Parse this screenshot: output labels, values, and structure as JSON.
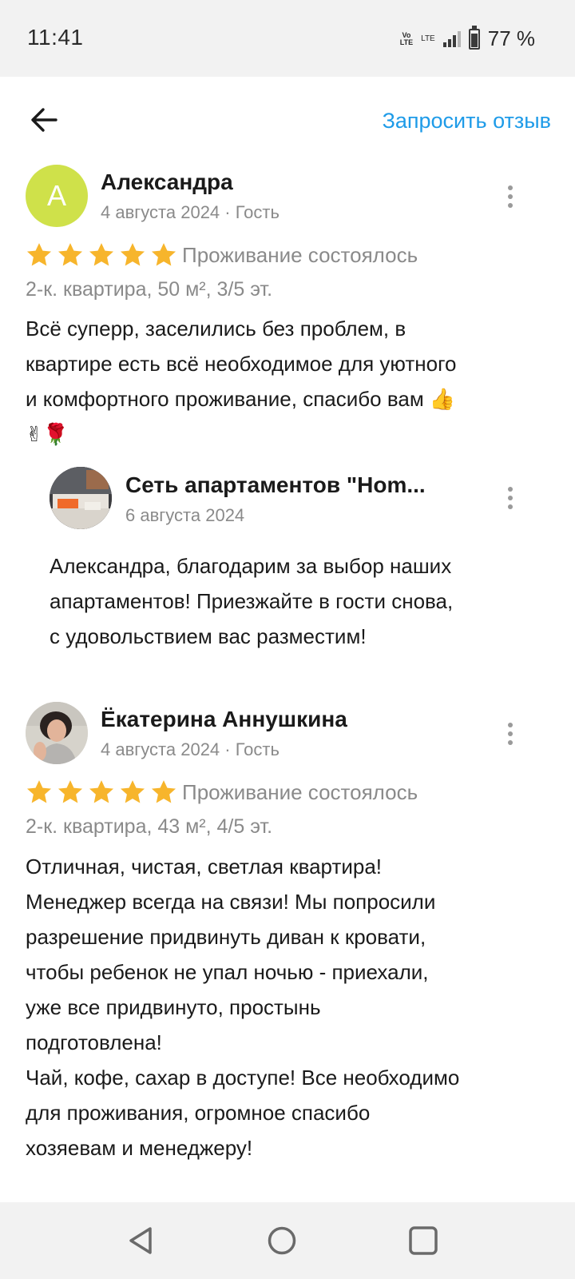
{
  "status_bar": {
    "time": "11:41",
    "network": "LTE",
    "volte": "Vo LTE",
    "battery_percent": "77 %",
    "battery_level": 0.77
  },
  "header": {
    "back_icon": "arrow-left-icon",
    "request_review_label": "Запросить отзыв",
    "accent_color": "#1e9be8"
  },
  "reviews": [
    {
      "avatar_letter": "А",
      "avatar_color": "#cfe14a",
      "author": "Александра",
      "meta": "4 августа 2024 · Гость",
      "rating": 5,
      "stay_status": "Проживание состоялось",
      "apartment": "2-к. квартира, 50 м², 3/5 эт.",
      "text": [
        "Всё суперр, заселились без проблем, в",
        "квартире есть всё необходимое для уютного",
        "и комфортного проживание, спасибо вам 👍",
        "✌🌹"
      ],
      "reply": {
        "author": "Сеть апартаментов \"Hom...",
        "date": "6 августа 2024",
        "text": [
          "Александра, благодарим за выбор наших",
          "апартаментов! Приезжайте в гости снова,",
          "с удовольствием вас разместим!"
        ]
      }
    },
    {
      "author": "Ёкатерина Аннушкина",
      "meta": "4 августа 2024 · Гость",
      "rating": 5,
      "stay_status": "Проживание состоялось",
      "apartment": "2-к. квартира, 43 м², 4/5 эт.",
      "text": [
        "Отличная, чистая, светлая квартира!",
        "Менеджер всегда на связи! Мы попросили",
        "разрешение придвинуть диван к кровати,",
        "чтобы ребенок не упал ночью - приехали,",
        "уже все придвинуто, простынь",
        "подготовлена!",
        "Чай, кофе, сахар в доступе! Все необходимо",
        "для проживания, огромное спасибо",
        "хозяевам и менеджеру!"
      ]
    }
  ],
  "colors": {
    "star": "#f7b52c",
    "muted_text": "#8a8a8a",
    "status_bar_bg": "#f2f2f2"
  },
  "nav_bar": {
    "back": "triangle-back-icon",
    "home": "circle-home-icon",
    "recents": "square-recents-icon"
  }
}
